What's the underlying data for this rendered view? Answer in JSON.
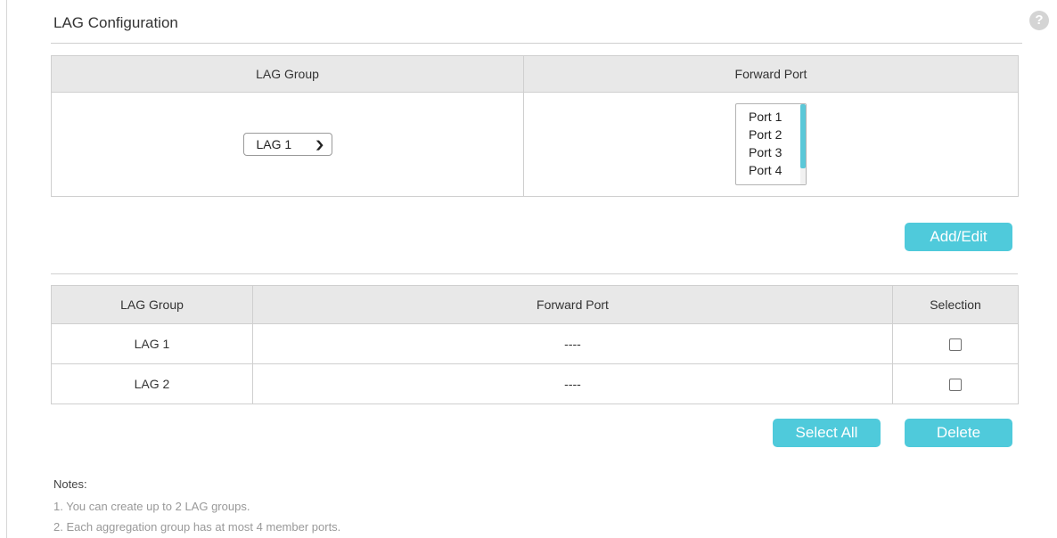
{
  "section_title": "LAG Configuration",
  "help_icon": "question-circle-icon",
  "config": {
    "headers": [
      "LAG Group",
      "Forward Port"
    ],
    "lag_select": {
      "value": "LAG 1"
    },
    "port_options": [
      "Port 1",
      "Port 2",
      "Port 3",
      "Port 4"
    ]
  },
  "buttons": {
    "add_edit": "Add/Edit",
    "select_all": "Select All",
    "delete": "Delete"
  },
  "list": {
    "headers": [
      "LAG Group",
      "Forward Port",
      "Selection"
    ],
    "rows": [
      {
        "group": "LAG 1",
        "ports": "----",
        "selected": false
      },
      {
        "group": "LAG 2",
        "ports": "----",
        "selected": false
      }
    ]
  },
  "notes": {
    "title": "Notes:",
    "items": [
      "1. You can create up to 2 LAG groups.",
      "2. Each aggregation group has at most 4 member ports."
    ]
  },
  "colors": {
    "accent": "#4fcadb",
    "header_bg": "#e8e8e8",
    "border": "#cfcfcf"
  }
}
